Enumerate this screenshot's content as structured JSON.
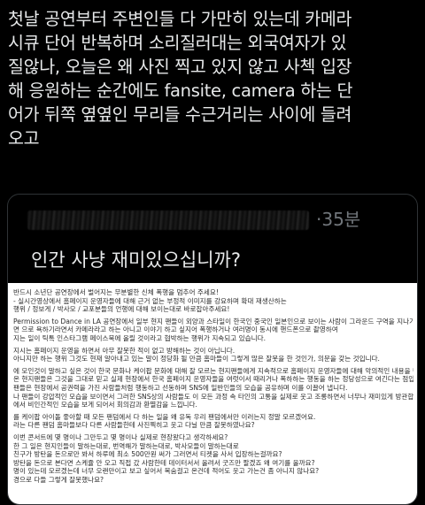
{
  "post": {
    "lines": [
      "첫날 공연부터 주변인들 다 가만히 있는데 카메라",
      "시큐 단어 반복하며 소리질러대는 외국여자가 있",
      "질않나, 오늘은 왜 사진 찍고 있지 않고 사첵 입장",
      "해 응원하는 순간에도 fansite, camera 하는 단",
      "어가 뒤쪽 옆옆인 무리들 수근거리는 사이에 들려",
      "오고"
    ]
  },
  "quote": {
    "time": "·35분",
    "text": "인간 사냥 재미있으십니까?"
  },
  "document": {
    "lines": [
      "반드시 소년단 공연장에서 벌어지는 무분별한 신체 폭행을 멈추어 주세요!",
      "- 실시간영상에서 홈페이지 운영자들에 대해 근거 없는 부정적 이미지를 강요하며 확대 재생산하는",
      "행위 / 정보게 / 박사모 / 교포분들의 언행에 대해 보이는대로 바로잡아주세요!",
      "",
      "Permission to Dance in LA 공연장에서 일부 현지 팬들이 외양과 스타일이 한국인 중국인 일본인으로 보이는 사람이 그라운드 구역을 지나가면",
      "면 으로 욕하기라면서 카메라라고 하는 아니고 이야기 하고 싶지어 폭행하거나 여러명이 동시에 핸드폰으로 촬영하여",
      "지는 일이 틱톡 인스타그램 페이스북에 올릴 것이라고 협박하는 행위가 지속되고 있습니다.",
      "",
      "지시는 홈페이지 운영을 하면서 아무 잘못한 적이 없고 방해하는 것이 아닙니다.",
      "아니지만 하는 행위 그것도 현재 알아내고 있는 말이 정당화 될 만큼 홈마들이 그렇게 많은 잘못을 한 것인가, 의문을 갖는 것입니다.",
      "",
      "에 모인것이 말하고 싶은 것이 한국 문화나 케이팝 문화에 대해 잘 모르는 현지팬들에게 지속적으로 홈페이지 운영자들에 대해 악의적인 내용을 번역하여 전하고",
      "온 현지팬들은 그것을 그대로 믿고 실제 현장에서 한국 홈페이지 운영자들을 여럿이서 때리거나 폭하하는 행동을 하는 정당성으로 여긴다는 점입니다.",
      "팬들은 현장에서 공권력을 가진 사람들처럼 행동하고 선동하며 SNS에 일반인들의 모습을 공유하며 이를 이끌어 냅니다.",
      "나 팬들이 강압적인 모습을 보이면서 그러한 SNS상의 사람들도 이 모든 과정 속 타인의 고통을 실제로 웃고 조롱하면서 너무나 재미있게 방관합니다.",
      "에서 비인간적인 모습을 보게 되어서 회의감과 환멸감을 느낍니다.",
      "",
      "를 케이팝 아이돌 좋아할 때 모든 팬덤에서 다 하는 일을 왜 유독 우리 팬덤에서만 이러는지 정말 모르겠어요.",
      "라는 다른 팬덤 홈마들보다 다른 사람들한테 사진찍히고 웃고 다닐 만큼 잘못하였나요?",
      "",
      "이번 콘서트에 몇 명이나 그만두고 몇 명이나 실제로 현장왔다고 생각하세요?",
      "한 그 일은 현지인들이 말하는대로, 번역해가 말하는대로, 박사모들이 말하는대로",
      "친구가 방탄을 돈으로만 봐서 하루에 최소 500만원 써가 그러면서 티켓을 사서 입장하는걸까요?",
      "방탄을 돈으로 본다면 스케쥴 안 오고 직접 갔 사람한테 데이터서서 올려서 굿즈만 팔겠죠 왜 여기를 올까요?",
      "명이 있는데 모르겠는데 너무 오랜만이고 보고 싶어서 목숨걸고 온건데 적어도 웃고 가는건 좀 아니지 않나요?",
      "경으로 다들 그렇게 잘못했나요?"
    ]
  },
  "colors": {
    "background": "#000000",
    "text": "#e7e9ea",
    "muted": "#71767b",
    "border": "#2f3336"
  }
}
